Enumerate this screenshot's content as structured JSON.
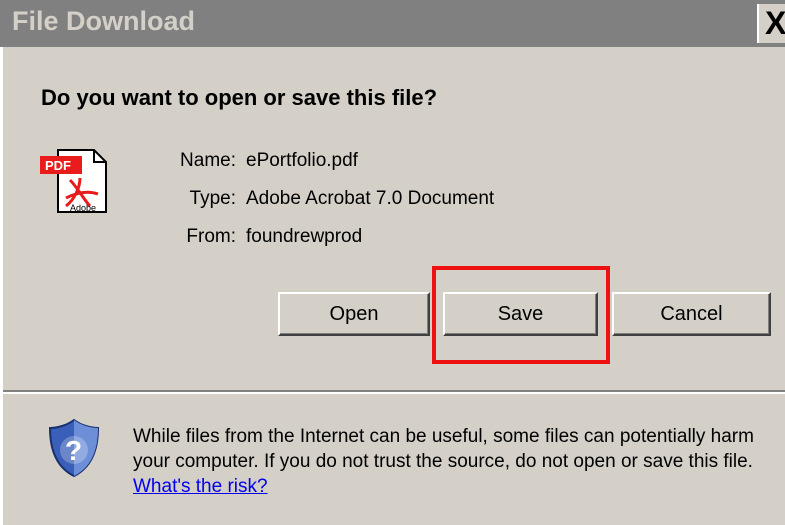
{
  "window": {
    "title": "File Download",
    "close_glyph": "X"
  },
  "prompt": "Do you want to open or save this file?",
  "file": {
    "icon": "pdf-file-icon",
    "icon_text_top": "PDF",
    "icon_text_bottom": "Adobe",
    "name_label": "Name:",
    "name_value": "ePortfolio.pdf",
    "type_label": "Type:",
    "type_value": "Adobe Acrobat 7.0 Document",
    "from_label": "From:",
    "from_value": "foundrewprod"
  },
  "buttons": {
    "open": "Open",
    "save": "Save",
    "cancel": "Cancel"
  },
  "highlight_color": "#ee1111",
  "warning": {
    "icon": "security-shield-icon",
    "text": "While files from the Internet can be useful, some files can potentially harm your computer. If you do not trust the source, do not open or save this file.",
    "link": "What's the risk?"
  }
}
